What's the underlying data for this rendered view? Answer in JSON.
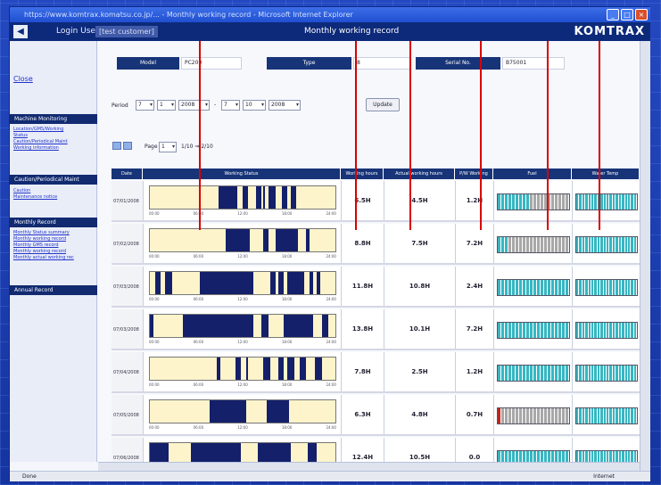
{
  "window": {
    "title": "https://www.komtrax.komatsu.co.jp/... - Monthly working record - Microsoft Internet Explorer"
  },
  "appbar": {
    "back_icon": "back-arrow-icon",
    "login_label": "Login User",
    "login_value": "[test customer]",
    "page_title": "Monthly working record",
    "logo": "KOMTRAX"
  },
  "sidebar": {
    "close": "Close",
    "sections": [
      {
        "title": "Machine Monitoring",
        "links": [
          "Location/GMS/Working",
          "Status",
          "Caution/Periodical Maint",
          "Working information"
        ]
      },
      {
        "title": "Caution/Periodical Maint",
        "links": [
          "Caution",
          "Maintenance notice"
        ]
      },
      {
        "title": "Monthly Record",
        "links": [
          "Monthly Status summary",
          "Monthly working record",
          "Monthly GMS record",
          "Monthly working record",
          "Monthly actual working rec"
        ]
      },
      {
        "title": "Annual Record",
        "links": []
      }
    ]
  },
  "info": {
    "model_label": "Model",
    "model_value": "PC200",
    "type_label": "Type",
    "type_value": "8",
    "serial_label": "Serial No.",
    "serial_value": "B75001"
  },
  "period": {
    "label": "Period",
    "from_month": "7",
    "from_day": "1",
    "from_year": "2008",
    "to_month": "7",
    "to_day": "10",
    "to_year": "2008",
    "update": "Update"
  },
  "pager": {
    "page_label": "Page",
    "page_value": "1",
    "range": "1/10 ⇒ 2/10"
  },
  "columns": [
    "Date",
    "Working Status",
    "Working hours",
    "Actual working hours",
    "P/W Working",
    "Fuel",
    "Water Temp"
  ],
  "ticks": [
    "00:00",
    "06:00",
    "12:00",
    "18:00",
    "24:00"
  ],
  "rows": [
    {
      "date": "07/01/2008",
      "hours": "6.5H",
      "actual": "4.5H",
      "pw": "1.2H",
      "fuel_level": 0.45,
      "segments": [
        [
          0.37,
          0.47
        ],
        [
          0.5,
          0.53
        ],
        [
          0.57,
          0.6
        ],
        [
          0.61,
          0.62
        ],
        [
          0.64,
          0.68
        ],
        [
          0.71,
          0.74
        ],
        [
          0.76,
          0.79
        ]
      ]
    },
    {
      "date": "07/02/2008",
      "hours": "8.8H",
      "actual": "7.5H",
      "pw": "7.2H",
      "fuel_level": 0.15,
      "segments": [
        [
          0.41,
          0.54
        ],
        [
          0.61,
          0.64
        ],
        [
          0.68,
          0.8
        ],
        [
          0.84,
          0.86
        ]
      ]
    },
    {
      "date": "07/03/2008",
      "hours": "11.8H",
      "actual": "10.8H",
      "pw": "2.4H",
      "fuel_level": 1.0,
      "segments": [
        [
          0.03,
          0.06
        ],
        [
          0.08,
          0.12
        ],
        [
          0.27,
          0.56
        ],
        [
          0.65,
          0.68
        ],
        [
          0.69,
          0.72
        ],
        [
          0.74,
          0.83
        ],
        [
          0.86,
          0.88
        ],
        [
          0.9,
          0.92
        ]
      ]
    },
    {
      "date": "07/03/2008",
      "hours": "13.8H",
      "actual": "10.1H",
      "pw": "7.2H",
      "fuel_level": 1.0,
      "segments": [
        [
          0.0,
          0.02
        ],
        [
          0.18,
          0.56
        ],
        [
          0.6,
          0.64
        ],
        [
          0.72,
          0.88
        ],
        [
          0.93,
          0.96
        ]
      ]
    },
    {
      "date": "07/04/2008",
      "hours": "7.8H",
      "actual": "2.5H",
      "pw": "1.2H",
      "fuel_level": 1.0,
      "segments": [
        [
          0.36,
          0.38
        ],
        [
          0.46,
          0.49
        ],
        [
          0.52,
          0.53
        ],
        [
          0.61,
          0.65
        ],
        [
          0.69,
          0.72
        ],
        [
          0.74,
          0.78
        ],
        [
          0.81,
          0.84
        ],
        [
          0.89,
          0.93
        ]
      ]
    },
    {
      "date": "07/05/2008",
      "hours": "6.3H",
      "actual": "4.8H",
      "pw": "0.7H",
      "fuel_level": 0.05,
      "segments": [
        [
          0.32,
          0.52
        ],
        [
          0.63,
          0.75
        ]
      ]
    },
    {
      "date": "07/06/2008",
      "hours": "12.4H",
      "actual": "10.5H",
      "pw": "0.0",
      "fuel_level": 1.0,
      "segments": [
        [
          0.0,
          0.1
        ],
        [
          0.22,
          0.49
        ],
        [
          0.58,
          0.76
        ],
        [
          0.85,
          0.9
        ]
      ]
    }
  ],
  "statusbar": {
    "left": "Done",
    "zone": "Internet"
  },
  "colors": {
    "fuel_fill": "#36b7c2",
    "fuel_empty": "#a8a8a8",
    "fuel_low": "#c0241c",
    "running": "#14206a",
    "idle": "#fdf4cc"
  }
}
